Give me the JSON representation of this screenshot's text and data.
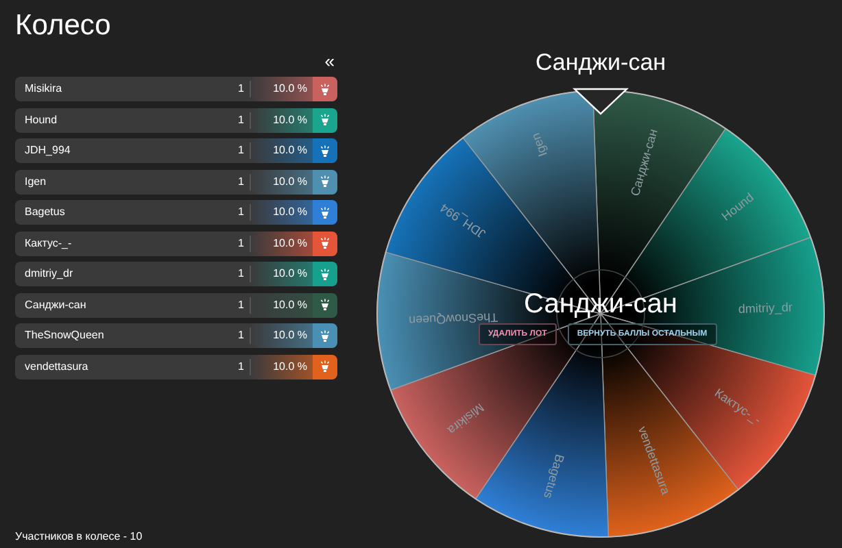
{
  "title": "Колесо",
  "collapse_button": "«",
  "participants": [
    {
      "name": "Misikira",
      "count": "1",
      "percent": "10.0 %",
      "color": "#c9625f"
    },
    {
      "name": "Hound",
      "count": "1",
      "percent": "10.0 %",
      "color": "#1aa58e"
    },
    {
      "name": "JDH_994",
      "count": "1",
      "percent": "10.0 %",
      "color": "#1672b8"
    },
    {
      "name": "Igen",
      "count": "1",
      "percent": "10.0 %",
      "color": "#4f8fb0"
    },
    {
      "name": "Bagetus",
      "count": "1",
      "percent": "10.0 %",
      "color": "#2f7fd6"
    },
    {
      "name": "Кактус-_-",
      "count": "1",
      "percent": "10.0 %",
      "color": "#e4553a"
    },
    {
      "name": "dmitriy_dr",
      "count": "1",
      "percent": "10.0 %",
      "color": "#17a08d"
    },
    {
      "name": "Санджи-сан",
      "count": "1",
      "percent": "10.0 %",
      "color": "#2f5a48"
    },
    {
      "name": "TheSnowQueen",
      "count": "1",
      "percent": "10.0 %",
      "color": "#4a90b5"
    },
    {
      "name": "vendettasura",
      "count": "1",
      "percent": "10.0 %",
      "color": "#e0621c"
    }
  ],
  "footer": "Участников в колесе - 10",
  "wheel": {
    "winner_title": "Санджи-сан",
    "center_label": "Санджи-сан",
    "segments": [
      {
        "label": "Санджи-сан",
        "color": "#2f5a48"
      },
      {
        "label": "Hound",
        "color": "#1aa58e"
      },
      {
        "label": "dmitriy_dr",
        "color": "#17a08d"
      },
      {
        "label": "Кактус-_-",
        "color": "#e4553a"
      },
      {
        "label": "vendettasura",
        "color": "#e0621c"
      },
      {
        "label": "Bagetus",
        "color": "#2f7fd6"
      },
      {
        "label": "Misikira",
        "color": "#c9625f"
      },
      {
        "label": "TheSnowQueen",
        "color": "#4a90b5"
      },
      {
        "label": "JDH_994",
        "color": "#1672b8"
      },
      {
        "label": "Igen",
        "color": "#4f8fb0"
      }
    ],
    "buttons": [
      {
        "label": "УДАЛИТЬ ЛОТ",
        "kind": "danger"
      },
      {
        "label": "ВЕРНУТЬ БАЛЛЫ ОСТАЛЬНЫМ",
        "kind": "primary"
      }
    ]
  }
}
